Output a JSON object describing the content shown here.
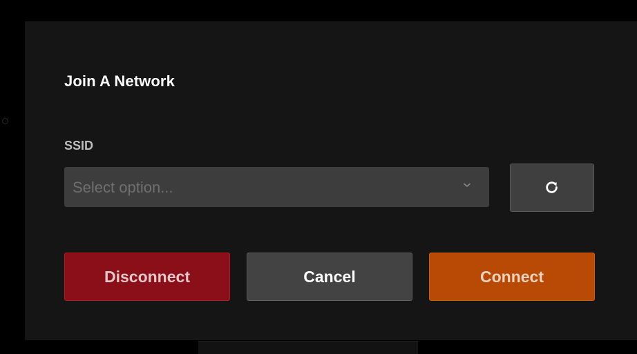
{
  "dialog": {
    "title": "Join A Network",
    "ssid_label": "SSID",
    "ssid_select": {
      "placeholder": "Select option...",
      "chevron_icon": "chevron-down-icon"
    },
    "refresh_icon": "refresh-icon",
    "buttons": {
      "disconnect": "Disconnect",
      "cancel": "Cancel",
      "connect": "Connect"
    }
  },
  "colors": {
    "background": "#000000",
    "dialog": "#151515",
    "input": "#3d3d3d",
    "disconnect": "#8a0f18",
    "cancel": "#434343",
    "connect": "#b84a05"
  }
}
